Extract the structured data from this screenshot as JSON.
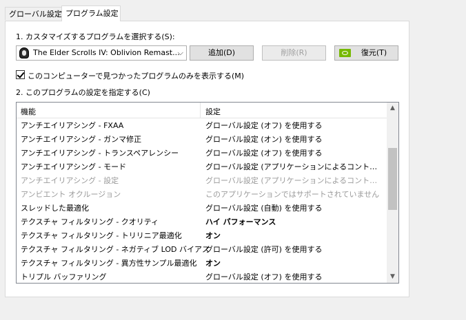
{
  "tabs": [
    {
      "label": "グローバル設定"
    },
    {
      "label": "プログラム設定"
    }
  ],
  "section1": {
    "label": "1. カスタマイズするプログラムを選択する(S):"
  },
  "program_select": {
    "value": "The Elder Scrolls IV: Oblivion Remast...",
    "icon": "oblivion-app-icon"
  },
  "buttons": {
    "add": "追加(D)",
    "remove": "削除(R)",
    "restore": "復元(T)"
  },
  "show_only_found": {
    "label": "このコンピューターで見つかったプログラムのみを表示する(M)",
    "checked": true
  },
  "section2": {
    "label": "2. このプログラムの設定を指定する(C)"
  },
  "table": {
    "headers": {
      "feature": "機能",
      "setting": "設定"
    },
    "rows": [
      {
        "feature": "アンチエイリアシング - FXAA",
        "setting": "グローバル設定 (オフ) を使用する",
        "dim": false,
        "bold": false
      },
      {
        "feature": "アンチエイリアシング - ガンマ修正",
        "setting": "グローバル設定 (オン) を使用する",
        "dim": false,
        "bold": false
      },
      {
        "feature": "アンチエイリアシング - トランスペアレンシー",
        "setting": "グローバル設定 (オフ) を使用する",
        "dim": false,
        "bold": false
      },
      {
        "feature": "アンチエイリアシング - モード",
        "setting": "グローバル設定 (アプリケーションによるコントロール) を...",
        "dim": false,
        "bold": false
      },
      {
        "feature": "アンチエイリアシング - 設定",
        "setting": "グローバル設定 (アプリケーションによるコントロール) を...",
        "dim": true,
        "bold": false
      },
      {
        "feature": "アンビエント オクルージョン",
        "setting": "このアプリケーションではサポートされていません",
        "dim": true,
        "bold": false
      },
      {
        "feature": "スレッドした最適化",
        "setting": "グローバル設定 (自動) を使用する",
        "dim": false,
        "bold": false
      },
      {
        "feature": "テクスチャ フィルタリング - クオリティ",
        "setting": "ハイ パフォーマンス",
        "dim": false,
        "bold": true
      },
      {
        "feature": "テクスチャ フィルタリング - トリリニア最適化",
        "setting": "オン",
        "dim": false,
        "bold": true
      },
      {
        "feature": "テクスチャ フィルタリング - ネガティブ LOD バイアス",
        "setting": "グローバル設定 (許可) を使用する",
        "dim": false,
        "bold": false
      },
      {
        "feature": "テクスチャ フィルタリング - 異方性サンプル最適化",
        "setting": "オン",
        "dim": false,
        "bold": true
      },
      {
        "feature": "トリプル バッファリング",
        "setting": "グローバル設定 (オフ) を使用する",
        "dim": false,
        "bold": false
      }
    ]
  },
  "colors": {
    "nvidia_green": "#76b900",
    "disabled_text": "#9a9a9a"
  }
}
